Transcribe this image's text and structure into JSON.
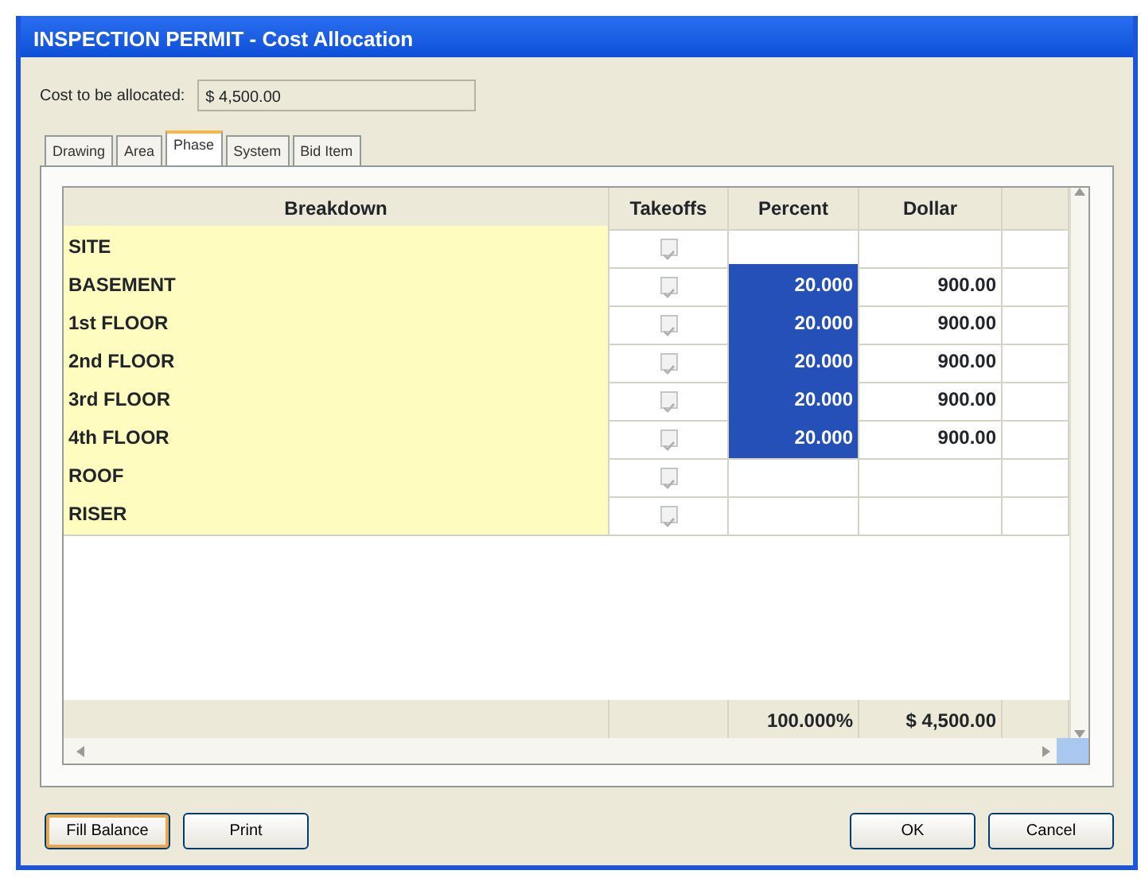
{
  "window": {
    "title": "INSPECTION PERMIT - Cost Allocation"
  },
  "cost": {
    "label": "Cost to be allocated:",
    "value": "$ 4,500.00"
  },
  "tabs": [
    {
      "label": "Drawing",
      "selected": false
    },
    {
      "label": "Area",
      "selected": false
    },
    {
      "label": "Phase",
      "selected": true
    },
    {
      "label": "System",
      "selected": false
    },
    {
      "label": "Bid Item",
      "selected": false
    }
  ],
  "table": {
    "columns": [
      "Breakdown",
      "Takeoffs",
      "Percent",
      "Dollar"
    ],
    "rows": [
      {
        "breakdown": "SITE",
        "takeoffs": true,
        "percent": "",
        "dollar": "",
        "selected": false
      },
      {
        "breakdown": "BASEMENT",
        "takeoffs": true,
        "percent": "20.000",
        "dollar": "900.00",
        "selected": true
      },
      {
        "breakdown": "1st FLOOR",
        "takeoffs": true,
        "percent": "20.000",
        "dollar": "900.00",
        "selected": true
      },
      {
        "breakdown": "2nd FLOOR",
        "takeoffs": true,
        "percent": "20.000",
        "dollar": "900.00",
        "selected": true
      },
      {
        "breakdown": "3rd FLOOR",
        "takeoffs": true,
        "percent": "20.000",
        "dollar": "900.00",
        "selected": true
      },
      {
        "breakdown": "4th FLOOR",
        "takeoffs": true,
        "percent": "20.000",
        "dollar": "900.00",
        "selected": true
      },
      {
        "breakdown": "ROOF",
        "takeoffs": true,
        "percent": "",
        "dollar": "",
        "selected": false
      },
      {
        "breakdown": "RISER",
        "takeoffs": true,
        "percent": "",
        "dollar": "",
        "selected": false
      }
    ],
    "totals": {
      "percent": "100.000%",
      "dollar": "$ 4,500.00"
    }
  },
  "buttons": {
    "left": [
      "Fill Balance",
      "Print"
    ],
    "right": [
      "OK",
      "Cancel"
    ]
  }
}
